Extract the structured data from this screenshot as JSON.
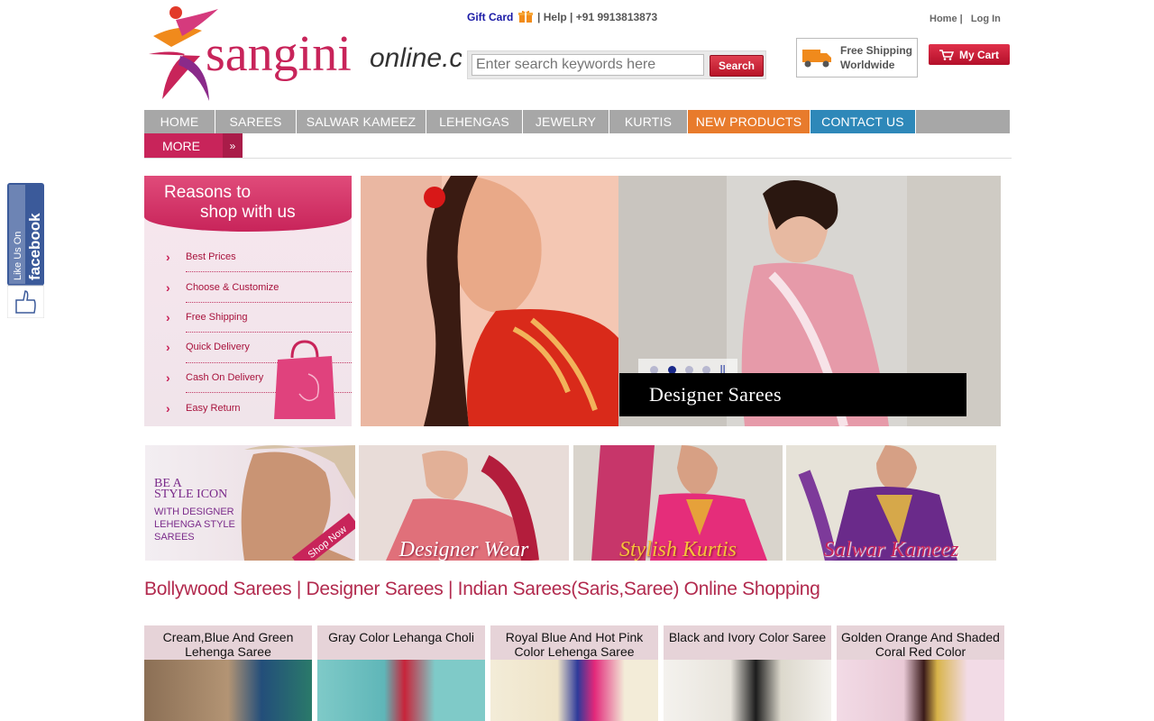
{
  "header": {
    "logo_text": "sanginionline.com",
    "gift_card": "Gift Card",
    "help": "| Help |",
    "phone": "+91 9913813873",
    "home_link": "Home |",
    "login_link": "Log In",
    "search_placeholder": "Enter search keywords here",
    "search_button": "Search",
    "shipping_line1": "Free Shipping",
    "shipping_line2": "Worldwide",
    "cart_label": "My Cart"
  },
  "nav": {
    "items": [
      {
        "label": "HOME"
      },
      {
        "label": "SAREES"
      },
      {
        "label": "SALWAR KAMEEZ"
      },
      {
        "label": "LEHENGAS"
      },
      {
        "label": "JEWELRY"
      },
      {
        "label": "KURTIS"
      },
      {
        "label": "NEW PRODUCTS"
      },
      {
        "label": "CONTACT US"
      }
    ],
    "more": "MORE"
  },
  "facebook": {
    "label": "Like Us On facebook"
  },
  "reasons": {
    "title_line1": "Reasons to",
    "title_line2": "shop with us",
    "items": [
      "Best Prices",
      "Choose & Customize",
      "Free Shipping",
      "Quick Delivery",
      "Cash On Delivery",
      "Easy Return"
    ]
  },
  "slider": {
    "caption": "Designer Sarees",
    "active_slide": 2,
    "total_slides": 4
  },
  "banners": [
    {
      "label": "BE A STYLE ICON WITH DESIGNER LEHENGA STYLE SAREES"
    },
    {
      "label": "Designer Wear"
    },
    {
      "label": "Stylish Kurtis"
    },
    {
      "label": "Salwar Kameez"
    }
  ],
  "banner_extra": {
    "shop_now": "Shop Now"
  },
  "page_title": "Bollywood Sarees | Designer Sarees | Indian Sarees(Saris,Saree) Online Shopping",
  "products": [
    {
      "name": "Cream,Blue And Green Lehenga Saree"
    },
    {
      "name": "Gray Color Lehanga Choli"
    },
    {
      "name": "Royal Blue And Hot Pink Color Lehenga Saree"
    },
    {
      "name": "Black and Ivory Color Saree"
    },
    {
      "name": "Golden Orange And Shaded Coral Red Color"
    }
  ],
  "colors": {
    "brand_pink": "#c8245a",
    "nav_gray": "#a7a7a7",
    "new_products": "#e87b2c",
    "contact": "#2e88b9",
    "title": "#b22a4e"
  }
}
